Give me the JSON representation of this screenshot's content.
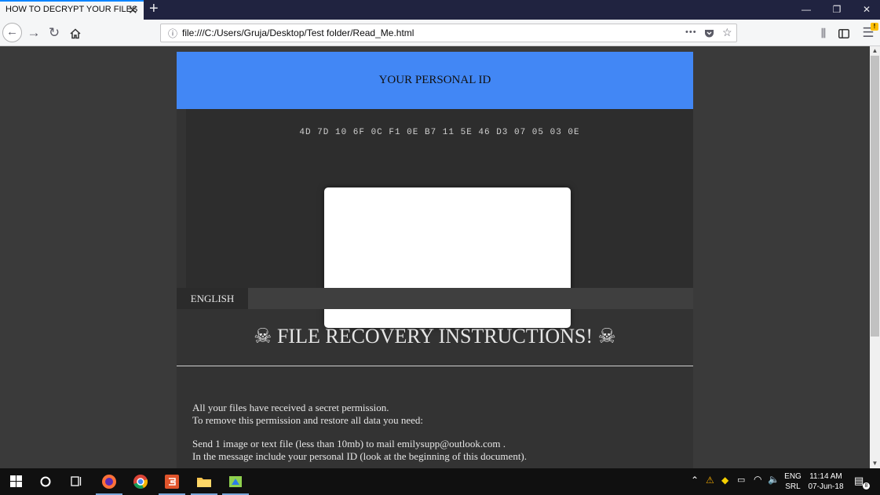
{
  "browser": {
    "tab_title": "HOW TO DECRYPT YOUR FILES",
    "tab_close": "✕",
    "new_tab": "+",
    "url": "file:///C:/Users/Gruja/Desktop/Test folder/Read_Me.html",
    "more_menu": "•••",
    "menu_badge": "!",
    "window_buttons": {
      "minimize": "—",
      "restore": "❐",
      "close": "✕"
    }
  },
  "page": {
    "header_title": "YOUR PERSONAL ID",
    "personal_id": "4D 7D 10 6F 0C F1 0E B7 11 5E 46 D3 07 05 03 0E",
    "language_tab": "ENGLISH",
    "instructions_title": "☠ FILE RECOVERY INSTRUCTIONS! ☠",
    "paragraph1_line1": "All your files have received a secret permission.",
    "paragraph1_line2": "To remove this permission and restore all data you need:",
    "paragraph2_line1": "Send 1 image or text file (less than 10mb) to mail emilysupp@outlook.com .",
    "paragraph2_line2": "In the message include your personal ID (look at the beginning of this document)."
  },
  "taskbar": {
    "lang_top": "ENG",
    "lang_bottom": "SRL",
    "time": "11:14 AM",
    "date": "07-Jun-18",
    "notification_count": "8"
  },
  "colors": {
    "header_blue": "#4287f5",
    "page_bg": "#333333",
    "firefox_tabbar": "#202340"
  }
}
